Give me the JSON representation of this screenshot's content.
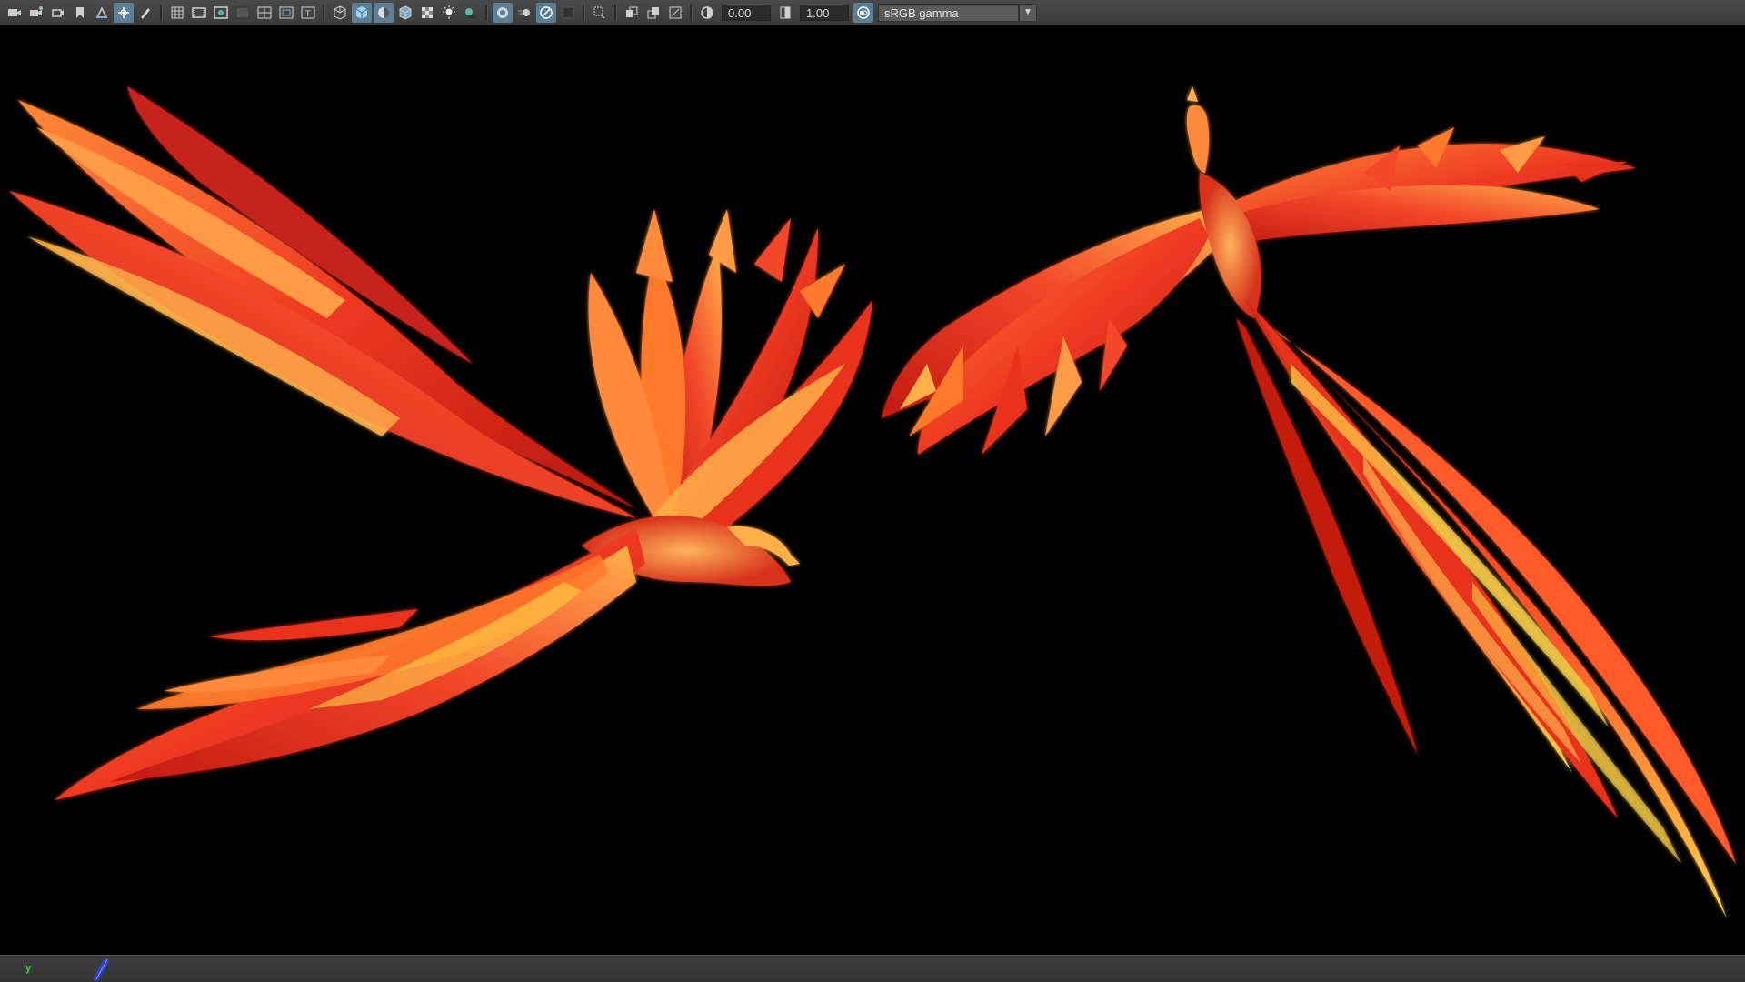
{
  "toolbar": {
    "exposure_value": "0.00",
    "gamma_value": "1.00",
    "color_space": "sRGB gamma",
    "icons": [
      "camera-icon",
      "camera-attributes-icon",
      "bookmark-camera-icon",
      "bookmark-icon",
      "image-plane-icon",
      "2d-pan-zoom-icon",
      "grease-pencil-icon",
      "grid-icon",
      "film-gate-icon",
      "resolution-gate-icon",
      "gate-mask-icon",
      "field-chart-icon",
      "safe-action-icon",
      "safe-title-icon",
      "wireframe-icon",
      "smooth-shade-icon",
      "default-material-icon",
      "wireframe-on-shaded-icon",
      "textured-icon",
      "use-all-lights-icon",
      "shadows-icon",
      "screen-space-ao-icon",
      "motion-blur-icon",
      "multisample-aa-icon",
      "depth-of-field-icon",
      "isolate-select-icon",
      "xray-icon",
      "xray-active-components-icon",
      "xray-joints-icon",
      "exposure-icon",
      "gamma-icon",
      "color-management-icon"
    ]
  },
  "colors": {
    "toolbar_bg": "#3c3c3c",
    "active_button": "#5c7f96",
    "viewport_bg": "#000000",
    "phoenix_red": "#e8321e",
    "phoenix_orange": "#ff7a2a",
    "phoenix_yellow": "#ffd24a"
  },
  "viewport": {
    "subject": "two-phoenix-models"
  },
  "bottom": {
    "axis_label": "y"
  }
}
